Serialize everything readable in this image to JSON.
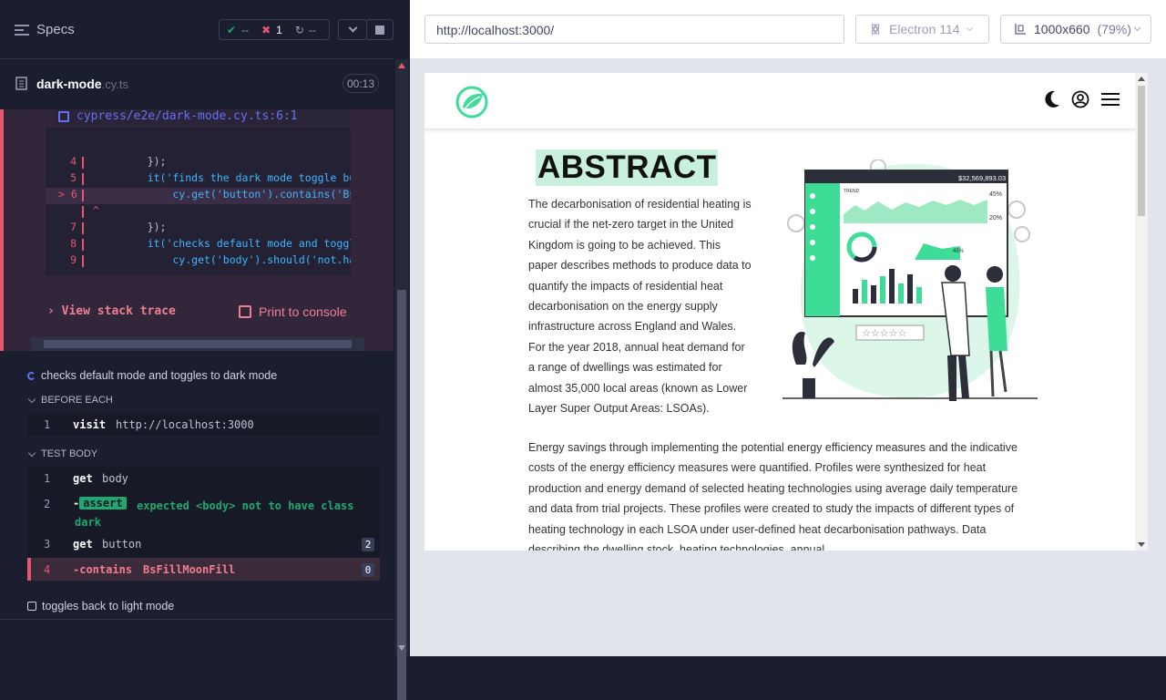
{
  "reporter": {
    "specs_label": "Specs",
    "stats": {
      "passed": "--",
      "failed": "1",
      "pending": "--"
    },
    "spec_file": {
      "name": "dark-mode",
      "ext": ".cy.ts",
      "duration": "00:13"
    },
    "error": {
      "file_link": "cypress/e2e/dark-mode.cy.ts:6:1",
      "code_lines": [
        {
          "num": "4",
          "text": "    });"
        },
        {
          "num": "5",
          "text": "    it('finds the dark mode toggle butto"
        },
        {
          "num": "> 6",
          "text": "        cy.get('button').contains('BsFi"
        },
        {
          "num": "",
          "text": "^"
        },
        {
          "num": "7",
          "text": "    });"
        },
        {
          "num": "8",
          "text": "    it('checks default mode and toggles"
        },
        {
          "num": "9",
          "text": "        cy.get('body').should('not.have"
        }
      ],
      "view_stack": "View stack trace",
      "print_console": "Print to console"
    },
    "tests": [
      {
        "title": "checks default mode and toggles to dark mode",
        "state": "running"
      },
      {
        "title": "toggles back to light mode",
        "state": "pending"
      }
    ],
    "before_each": {
      "label": "BEFORE EACH",
      "commands": [
        {
          "num": "1",
          "cmd": "visit",
          "arg": "http://localhost:3000"
        }
      ]
    },
    "test_body": {
      "label": "TEST BODY",
      "commands": [
        {
          "num": "1",
          "cmd": "get",
          "arg": "body"
        },
        {
          "num": "2",
          "cmd": "assert",
          "arg": "expected <body> not to have class dark"
        },
        {
          "num": "3",
          "cmd": "get",
          "arg": "button",
          "badge": "2"
        },
        {
          "num": "4",
          "cmd": "-contains",
          "arg": "BsFillMoonFill",
          "badge": "0"
        }
      ]
    }
  },
  "aut": {
    "url": "http://localhost:3000/",
    "browser": "Electron 114",
    "viewport": "1000x660",
    "zoom": "(79%)",
    "page": {
      "heading": "ABSTRACT",
      "para1": "The decarbonisation of residential heating is crucial if the net-zero target in the United Kingdom is going to be achieved. This paper describes methods to produce data to quantify the impacts of residential heat decarbonisation on the energy supply infrastructure across England and Wales. For the year 2018, annual heat demand for a range of dwellings was estimated for almost 35,000 local areas (known as Lower Layer Super Output Areas: LSOAs).",
      "para2": "Energy savings through implementing the potential energy efficiency measures and the indicative costs of the energy efficiency measures were quantified. Profiles were synthesized for heat production and energy demand of selected heating technologies using average daily temperature and data from trial projects. These profiles were created to study the impacts of different types of heating technology in each LSOA under user-defined heat decarbonisation pathways. Data describing the dwelling stock, heating technologies, annual",
      "dashboard_amount": "$32,569,893.03",
      "dashboard_pct1": "45%",
      "dashboard_pct2": "20%",
      "dashboard_pct3": "45%",
      "trend": "TREND"
    }
  },
  "colors": {
    "accent_fail": "#e45770",
    "accent_pass": "#1fa971",
    "link": "#6470f3",
    "brand_green": "#3ddc97"
  }
}
